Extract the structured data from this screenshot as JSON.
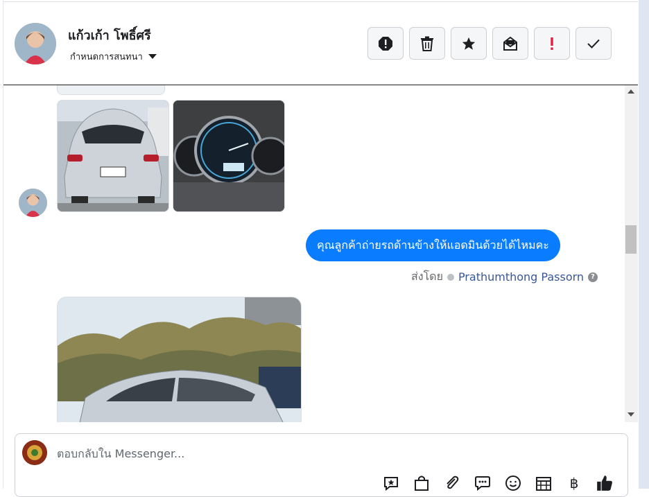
{
  "header": {
    "contact_name": "แก้วเก้า โพธิ์ศรี",
    "assign_label": "กำหนดการสนทนา",
    "actions": [
      {
        "name": "spam-button",
        "icon": "alert-octagon-icon"
      },
      {
        "name": "delete-button",
        "icon": "trash-icon"
      },
      {
        "name": "star-button",
        "icon": "star-icon"
      },
      {
        "name": "mark-unread-button",
        "icon": "envelope-open-icon"
      },
      {
        "name": "priority-button",
        "icon": "exclamation-icon"
      },
      {
        "name": "done-button",
        "icon": "check-icon"
      }
    ]
  },
  "conversation": {
    "outgoing_message": "คุณลูกค้าถ่ายรถด้านข้างให้แอดมินด้วยได้ไหมคะ",
    "sent_by_label": "ส่งโดย",
    "sent_by_name": "Prathumthong Passorn",
    "help_glyph": "?"
  },
  "composer": {
    "placeholder": "ตอบกลับใน Messenger...",
    "tools": [
      "saved-reply-icon",
      "shopping-bag-icon",
      "paperclip-icon",
      "chat-dots-icon",
      "smiley-icon",
      "calendar-icon",
      "baht-icon",
      "thumbs-up-icon"
    ],
    "baht_glyph": "฿"
  },
  "colors": {
    "accent": "#0a7cff",
    "priority_red": "#e41e3f",
    "link": "#385898"
  }
}
